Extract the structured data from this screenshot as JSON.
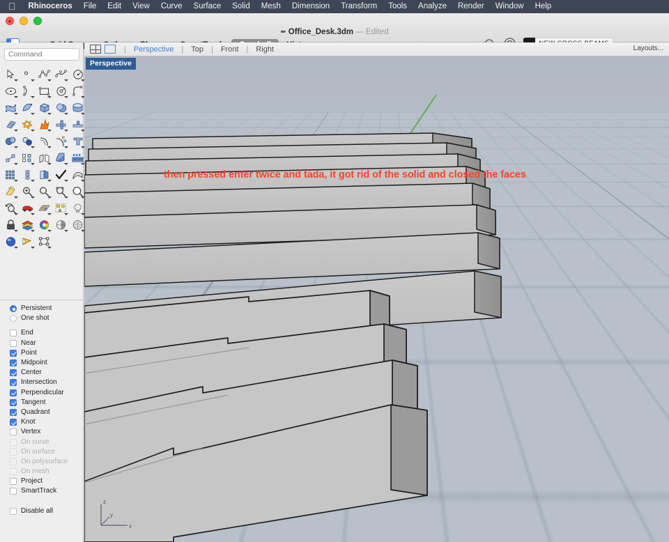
{
  "menu": {
    "apple_icon": "apple-icon",
    "items": [
      {
        "label": "Rhinoceros",
        "bold": true
      },
      {
        "label": "File",
        "bold": false
      },
      {
        "label": "Edit",
        "bold": false
      },
      {
        "label": "View",
        "bold": false
      },
      {
        "label": "Curve",
        "bold": false
      },
      {
        "label": "Surface",
        "bold": false
      },
      {
        "label": "Solid",
        "bold": false
      },
      {
        "label": "Mesh",
        "bold": false
      },
      {
        "label": "Dimension",
        "bold": false
      },
      {
        "label": "Transform",
        "bold": false
      },
      {
        "label": "Tools",
        "bold": false
      },
      {
        "label": "Analyze",
        "bold": false
      },
      {
        "label": "Render",
        "bold": false
      },
      {
        "label": "Window",
        "bold": false
      },
      {
        "label": "Help",
        "bold": false
      }
    ]
  },
  "titlebar": {
    "document_name": "Office_Desk.3dm",
    "edited_label": "— Edited",
    "toggles": [
      {
        "label": "Grid Snap",
        "on": false
      },
      {
        "label": "Ortho",
        "on": false
      },
      {
        "label": "Planar",
        "on": false
      },
      {
        "label": "SmartTrack",
        "on": false
      },
      {
        "label": "Gumball",
        "on": true
      },
      {
        "label": "History",
        "on": false
      }
    ],
    "layer": {
      "name": "NEW CROSS BEAMS",
      "color": "#1c1c1c"
    }
  },
  "command": {
    "placeholder": "Command",
    "value": ""
  },
  "viewport_tabs": {
    "tabs": [
      {
        "label": "Perspective",
        "active": true
      },
      {
        "label": "Top",
        "active": false
      },
      {
        "label": "Front",
        "active": false
      },
      {
        "label": "Right",
        "active": false
      }
    ],
    "layouts_label": "Layouts..."
  },
  "viewport": {
    "title": "Perspective",
    "annotation": "then pressed enter twice and tada, it got rid of the solid and closed the faces",
    "annotation_color": "#f1462f",
    "background_color": "#b5bcc6",
    "grid_color": "#7884  94",
    "axis_labels": {
      "x": "x",
      "y": "y",
      "z": "z"
    }
  },
  "osnap": {
    "modes": [
      {
        "label": "Persistent",
        "type": "radio",
        "checked": true,
        "disabled": false
      },
      {
        "label": "One shot",
        "type": "radio",
        "checked": false,
        "disabled": false
      }
    ],
    "snaps": [
      {
        "label": "End",
        "checked": false,
        "disabled": false
      },
      {
        "label": "Near",
        "checked": false,
        "disabled": false
      },
      {
        "label": "Point",
        "checked": true,
        "disabled": false
      },
      {
        "label": "Midpoint",
        "checked": true,
        "disabled": false
      },
      {
        "label": "Center",
        "checked": true,
        "disabled": false
      },
      {
        "label": "Intersection",
        "checked": true,
        "disabled": false
      },
      {
        "label": "Perpendicular",
        "checked": true,
        "disabled": false
      },
      {
        "label": "Tangent",
        "checked": true,
        "disabled": false
      },
      {
        "label": "Quadrant",
        "checked": true,
        "disabled": false
      },
      {
        "label": "Knot",
        "checked": true,
        "disabled": false
      },
      {
        "label": "Vertex",
        "checked": false,
        "disabled": false
      },
      {
        "label": "On curve",
        "checked": false,
        "disabled": true
      },
      {
        "label": "On surface",
        "checked": false,
        "disabled": true
      },
      {
        "label": "On polysurface",
        "checked": false,
        "disabled": true
      },
      {
        "label": "On mesh",
        "checked": false,
        "disabled": true
      },
      {
        "label": "Project",
        "checked": false,
        "disabled": false
      },
      {
        "label": "SmartTrack",
        "checked": false,
        "disabled": false
      }
    ],
    "disable_all": {
      "label": "Disable all",
      "checked": false
    }
  },
  "toolbar_icons": [
    "select-arrow-icon",
    "point-icon",
    "polyline-icon",
    "curve-interp-icon",
    "circle-icon",
    "ellipse-icon",
    "arc-icon",
    "rectangle-icon",
    "polygon-icon",
    "fillet-curve-icon",
    "surface-cv-icon",
    "surface-corner-icon",
    "box-icon",
    "sphere-icon",
    "cylinder-icon",
    "surface-edit-icon",
    "boolean-union-icon",
    "explode-icon",
    "join-icon",
    "trim-icon",
    "boolean-difference-icon",
    "boolean-intersection-icon",
    "offset-curve-icon",
    "offset-surface-icon",
    "text-icon",
    "move-icon",
    "copy-icon",
    "mirror-icon",
    "extrude-icon",
    "array-icon",
    "grid-array-icon",
    "scale-icon",
    "rotate-icon",
    "check-icon",
    "flow-icon",
    "bend-icon",
    "zoom-in-icon",
    "zoom-window-icon",
    "zoom-selected-icon",
    "zoom-extents-icon",
    "undo-view-icon",
    "pan-car-icon",
    "grid-plane-icon",
    "group-icon",
    "light-bulb-icon",
    "lock-icon",
    "layers-icon",
    "color-wheel-icon",
    "shade-icon",
    "ghosted-icon",
    "render-icon",
    "camera-icon",
    "named-view-icon"
  ]
}
